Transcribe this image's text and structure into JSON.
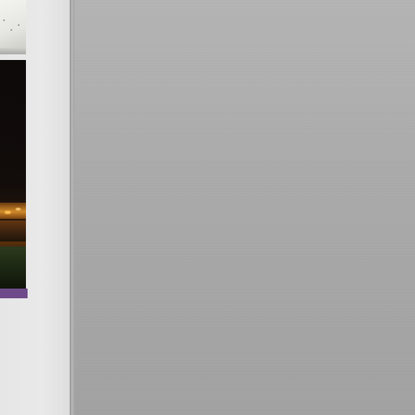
{
  "sidebar": {
    "thumbnails": [
      {
        "icon": "landscape-thumbnail-icon",
        "subject": "daylight"
      },
      {
        "icon": "night-city-thumbnail-icon",
        "subject": "night"
      }
    ],
    "selection_color": "#6e4a8a"
  },
  "colors": {
    "sidebar_bg": "#e6e6e6",
    "canvas_bg": "#aaaaaa",
    "accent": "#6e4a8a"
  }
}
